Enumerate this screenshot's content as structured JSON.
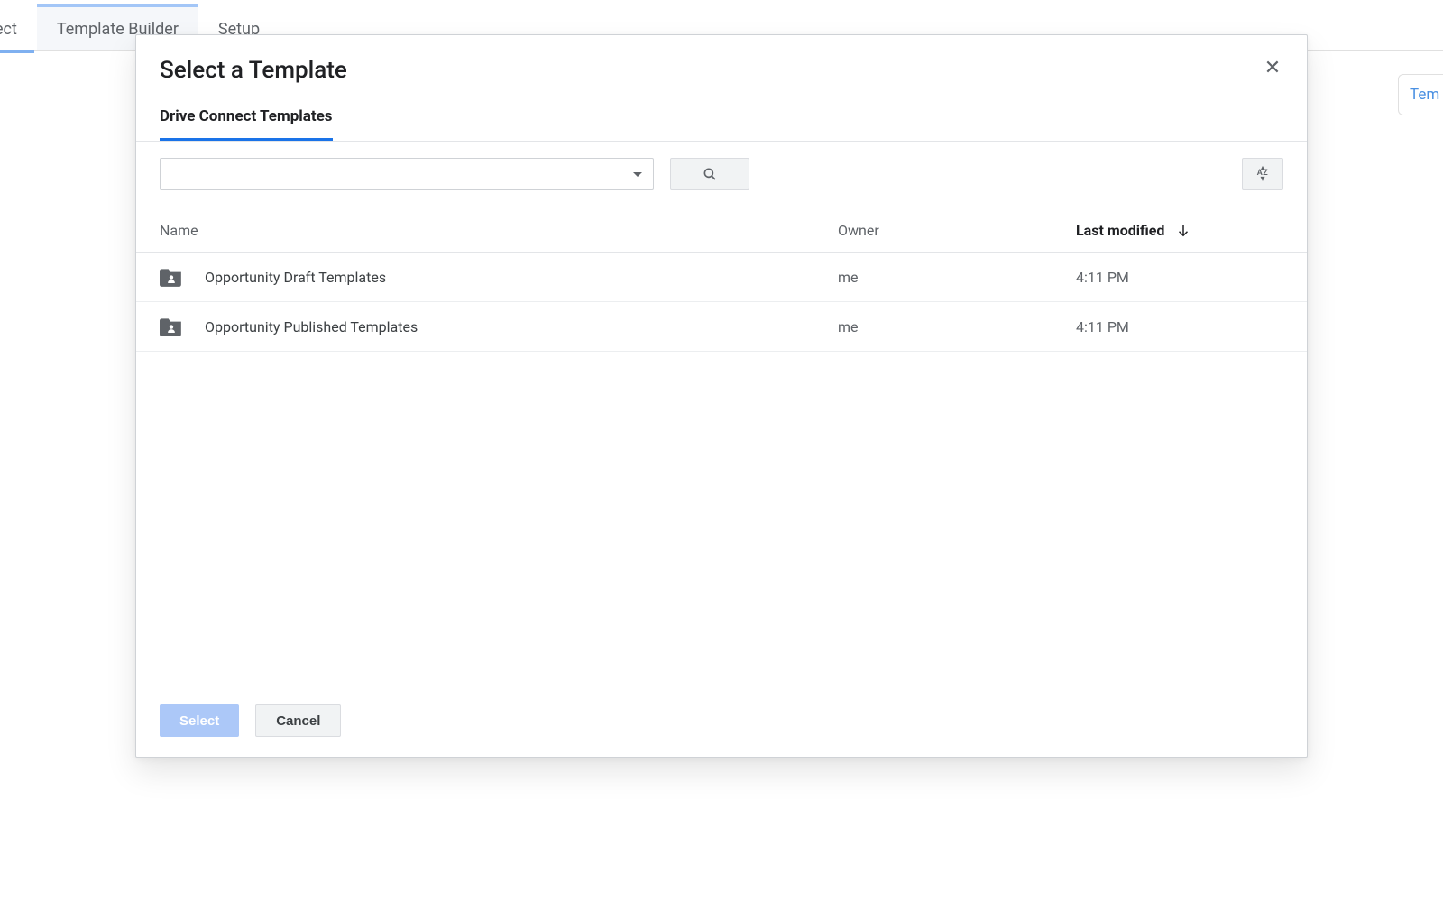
{
  "background": {
    "tab_partial": "ect",
    "tab_template_builder": "Template Builder",
    "tab_setup": "Setup",
    "right_text": "Tem"
  },
  "modal": {
    "title": "Select a Template",
    "inner_tab": "Drive Connect Templates",
    "columns": {
      "name": "Name",
      "owner": "Owner",
      "modified": "Last modified"
    },
    "rows": [
      {
        "name": "Opportunity Draft Templates",
        "owner": "me",
        "modified": "4:11 PM"
      },
      {
        "name": "Opportunity Published Templates",
        "owner": "me",
        "modified": "4:11 PM"
      }
    ],
    "footer": {
      "select": "Select",
      "cancel": "Cancel"
    }
  }
}
